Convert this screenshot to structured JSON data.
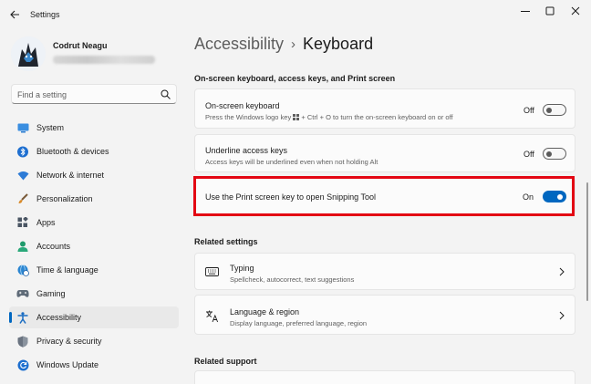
{
  "window": {
    "title": "Settings"
  },
  "user": {
    "name": "Codrut Neagu"
  },
  "search": {
    "placeholder": "Find a setting"
  },
  "sidebar": {
    "items": [
      {
        "label": "System",
        "icon": "system-icon",
        "color": "#2f7fd1"
      },
      {
        "label": "Bluetooth & devices",
        "icon": "bluetooth-icon",
        "color": "#1e6fd0"
      },
      {
        "label": "Network & internet",
        "icon": "wifi-icon",
        "color": "#2d7bd6"
      },
      {
        "label": "Personalization",
        "icon": "brush-icon",
        "color": "#d98b2b"
      },
      {
        "label": "Apps",
        "icon": "apps-icon",
        "color": "#4a5563"
      },
      {
        "label": "Accounts",
        "icon": "accounts-icon",
        "color": "#1f9a6b"
      },
      {
        "label": "Time & language",
        "icon": "globe-clock-icon",
        "color": "#2b86d1"
      },
      {
        "label": "Gaming",
        "icon": "gaming-icon",
        "color": "#5f6b78"
      },
      {
        "label": "Accessibility",
        "icon": "accessibility-icon",
        "color": "#1a6cc2",
        "active": true
      },
      {
        "label": "Privacy & security",
        "icon": "shield-icon",
        "color": "#6a7380"
      },
      {
        "label": "Windows Update",
        "icon": "update-icon",
        "color": "#1d6fcf"
      }
    ]
  },
  "breadcrumb": {
    "parent": "Accessibility",
    "separator": "›",
    "current": "Keyboard"
  },
  "sections": {
    "onscreen": "On-screen keyboard, access keys, and Print screen",
    "related_settings": "Related settings",
    "related_support": "Related support"
  },
  "settings": {
    "osk": {
      "title": "On-screen keyboard",
      "desc_before": "Press the Windows logo key",
      "desc_after": "+ Ctrl + O to turn the on-screen keyboard on or off",
      "state": "Off"
    },
    "underline": {
      "title": "Underline access keys",
      "desc": "Access keys will be underlined even when not holding Alt",
      "state": "Off"
    },
    "printscreen": {
      "title": "Use the Print screen key to open Snipping Tool",
      "state": "On"
    }
  },
  "related": {
    "typing": {
      "title": "Typing",
      "desc": "Spellcheck, autocorrect, text suggestions",
      "icon": "keyboard-icon"
    },
    "language": {
      "title": "Language & region",
      "desc": "Display language, preferred language, region",
      "icon": "language-icon"
    }
  },
  "colors": {
    "accent": "#0067c0",
    "highlight": "#e30613"
  }
}
